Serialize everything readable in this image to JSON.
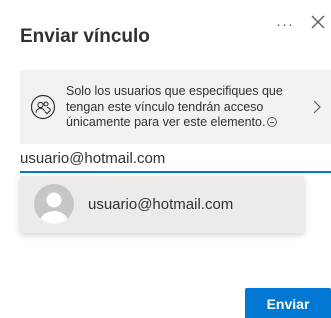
{
  "dialog": {
    "title": "Enviar vínculo",
    "more_label": "···",
    "close_icon": "close-icon"
  },
  "notice": {
    "icon": "people-link-icon",
    "line1": "Solo los usuarios que especifiques que",
    "line2": "tengan este vínculo tendrán acceso",
    "line3": "únicamente para ver este elemento.",
    "chevron_icon": "chevron-right-icon"
  },
  "recipient": {
    "value": "usuario@hotmail.com"
  },
  "suggestion": {
    "email": "usuario@hotmail.com",
    "avatar_icon": "person-icon"
  },
  "actions": {
    "send_label": "Enviar"
  },
  "colors": {
    "accent": "#0078d4",
    "panel_bg": "#f3f2f1",
    "suggestion_bg": "#edebe9",
    "avatar_bg": "#c8c6c4"
  }
}
